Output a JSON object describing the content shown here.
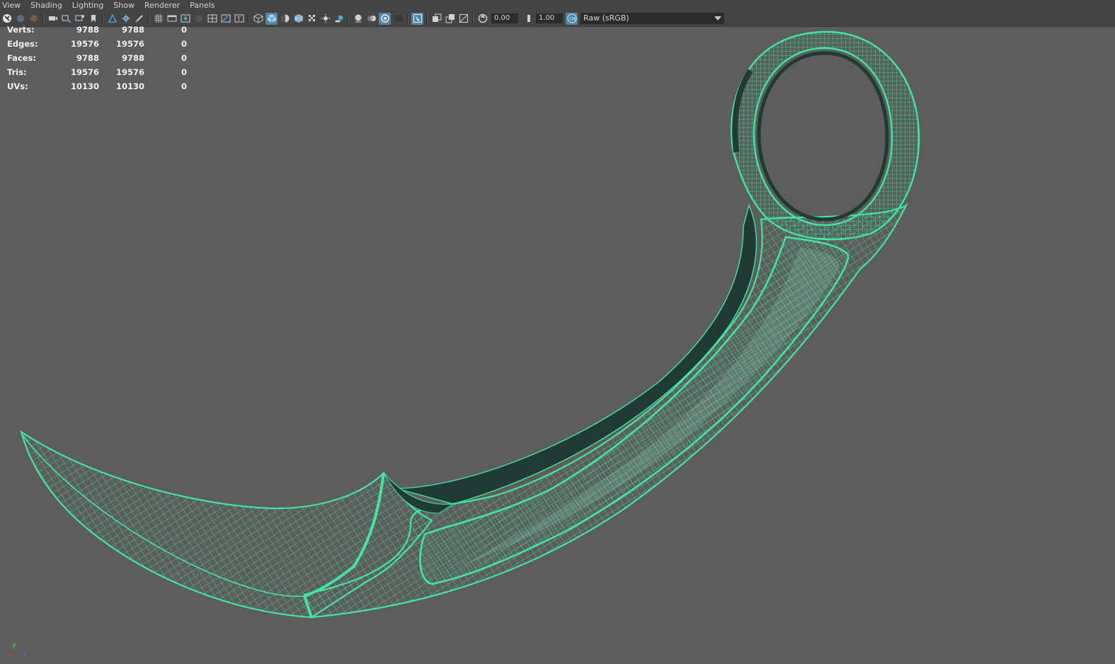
{
  "menu": [
    "View",
    "Shading",
    "Lighting",
    "Show",
    "Renderer",
    "Panels"
  ],
  "toolbar": {
    "exposure_value": "0.00",
    "gamma_value": "1.00",
    "colorspace_label": "Raw (sRGB)"
  },
  "hud": {
    "rows": [
      {
        "label": "Verts:",
        "values": [
          "9788",
          "9788",
          "0"
        ]
      },
      {
        "label": "Edges:",
        "values": [
          "19576",
          "19576",
          "0"
        ]
      },
      {
        "label": "Faces:",
        "values": [
          "9788",
          "9788",
          "0"
        ]
      },
      {
        "label": "Tris:",
        "values": [
          "19576",
          "19576",
          "0"
        ]
      },
      {
        "label": "UVs:",
        "values": [
          "10130",
          "10130",
          "0"
        ]
      }
    ]
  },
  "axis": {
    "y": "y",
    "x": "x",
    "z": "z"
  },
  "colors": {
    "viewport_bg": "#5d5d5d",
    "wire": "#40e6a0",
    "wire_dark": "#1f3b33",
    "panel_bg": "#444444",
    "active_blue": "#5285a6"
  }
}
